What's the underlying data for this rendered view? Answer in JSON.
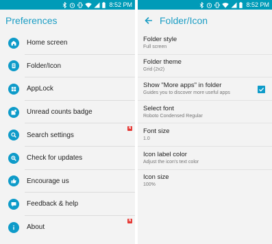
{
  "status_bar": {
    "time": "8:52 PM",
    "icons": [
      "bluetooth-icon",
      "alarm-icon",
      "vibrate-icon",
      "wifi-icon",
      "signal-icon",
      "battery-icon"
    ]
  },
  "left": {
    "title": "Preferences",
    "items": [
      {
        "label": "Home screen",
        "icon": "home-icon",
        "badge": ""
      },
      {
        "label": "Folder/Icon",
        "icon": "folder-icon",
        "badge": ""
      },
      {
        "label": "AppLock",
        "icon": "grid-icon",
        "badge": ""
      },
      {
        "label": "Unread counts badge",
        "icon": "badge-icon",
        "badge": ""
      },
      {
        "label": "Search settings",
        "icon": "search-icon",
        "badge": "N"
      },
      {
        "label": "Check for updates",
        "icon": "update-icon",
        "badge": ""
      },
      {
        "label": "Encourage us",
        "icon": "thumbs-up-icon",
        "badge": ""
      },
      {
        "label": "Feedback & help",
        "icon": "chat-icon",
        "badge": ""
      },
      {
        "label": "About",
        "icon": "info-icon",
        "badge": "N"
      }
    ]
  },
  "right": {
    "title": "Folder/Icon",
    "items": [
      {
        "title": "Folder style",
        "subtitle": "Full screen"
      },
      {
        "title": "Folder theme",
        "subtitle": "Grid (2x2)"
      },
      {
        "title": "Show \"More apps\" in folder",
        "subtitle": "Guides you to discover more useful apps",
        "checked": true
      },
      {
        "title": "Select font",
        "subtitle": "Roboto Condensed Regular"
      },
      {
        "title": "Font size",
        "subtitle": "1.0"
      },
      {
        "title": "Icon label color",
        "subtitle": "Adjust the icon's text color"
      },
      {
        "title": "Icon size",
        "subtitle": "100%"
      }
    ]
  },
  "colors": {
    "status_bar": "#009bb8",
    "accent": "#0e9bc9",
    "title": "#1a9dc4",
    "badge": "#e53935",
    "background": "#f3f3f3"
  }
}
